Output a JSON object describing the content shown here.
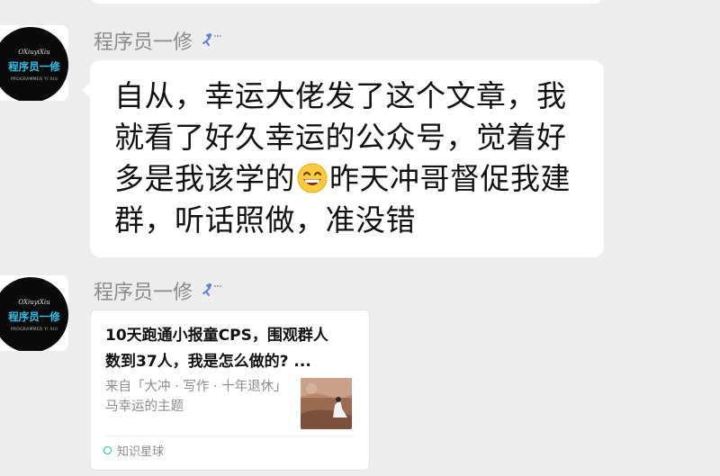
{
  "messages": [
    {
      "sender": "程序员一修",
      "avatar_text": {
        "script": "OXiuyiXiu",
        "name": "程序员一修",
        "sub": "PROGRAMMER YI XIU"
      },
      "text_before_emoji": "自从，幸运大佬发了这个文章，我就看了好久幸运的公众号，觉着好多是我该学的",
      "emoji": "grinning-face-with-smiling-eyes-emoji",
      "text_after_emoji": "昨天冲哥督促我建群，听话照做，准没错"
    },
    {
      "sender": "程序员一修",
      "avatar_text": {
        "script": "OXiuyiXiu",
        "name": "程序员一修",
        "sub": "PROGRAMMER YI XIU"
      },
      "card": {
        "title": "10天跑通小报童CPS，围观群人数到37人，我是怎么做的? ...",
        "description": "来自「大冲 · 写作 · 十年退休」马幸运的主题",
        "source": "知识星球",
        "thumbnail": "illustration-thumbnail"
      }
    }
  ],
  "colors": {
    "background": "#ededed",
    "bubble": "#ffffff",
    "sender": "#8a8a8a",
    "avatar_name": "#2fc0e8",
    "source_icon": "#18c09a"
  }
}
